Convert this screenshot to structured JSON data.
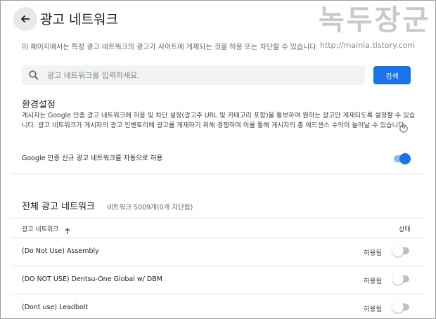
{
  "header": {
    "title": "광고 네트워크"
  },
  "watermark": {
    "text": "녹두장군",
    "url": "http://mainia.tistory.com"
  },
  "description": "이 페이지에서는 특정 광고 네트워크의 광고가 사이트에 게재되는 것을 허용 또는 차단할 수 있습니다.",
  "search": {
    "placeholder": "광고 네트워크를 입력하세요.",
    "button_label": "검색"
  },
  "settings": {
    "title": "환경설정",
    "description": "게시자는 Google 인증 광고 네트워크에 허용 및 차단 설정(광고주 URL 및 카테고리 포함)을 통보하여 원하는 광고만 게재되도록 설정할 수 있습니다. 광고 네트워크가 게시자의 광고 인벤토리에 광고를 게재하기 위해 경쟁하며 이를 통해 게시자의 총 애드센스 수익이 늘어날 수 있습니다.",
    "auto_allow_label": "Google 인증 신규 광고 네트워크를 자동으로 허용",
    "auto_allow_on": true
  },
  "networks": {
    "title": "전체 광고 네트워크",
    "count_text": "네트워크 5009개(0개 차단됨)",
    "columns": {
      "name": "광고 네트워크",
      "status": "상태"
    },
    "rows": [
      {
        "name": "(Do Not Use) Assembly",
        "status": "허용됨",
        "enabled": false
      },
      {
        "name": "(DO NOT USE) Dentsu-One Global w/ DBM",
        "status": "허용됨",
        "enabled": false
      },
      {
        "name": "(Dont use) Leadbolt",
        "status": "허용됨",
        "enabled": false
      }
    ]
  },
  "colors": {
    "accent": "#1a73e8",
    "toggle_track_on": "#8ab4f8",
    "search_bg": "#f1f3f4"
  }
}
